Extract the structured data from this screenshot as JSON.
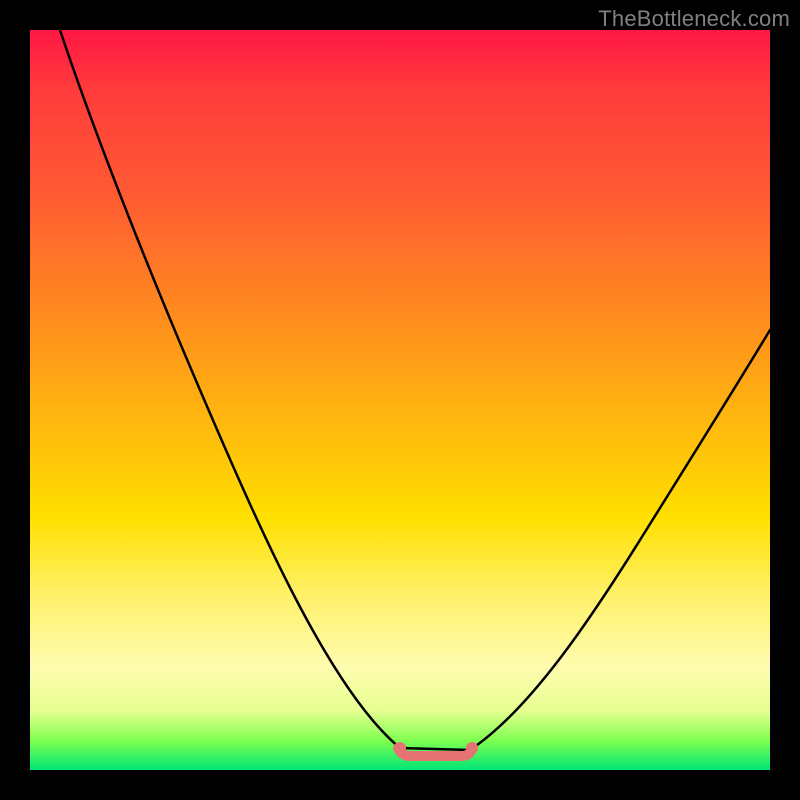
{
  "watermark": "TheBottleneck.com",
  "chart_data": {
    "type": "line",
    "title": "",
    "xlabel": "",
    "ylabel": "",
    "xlim": [
      0,
      100
    ],
    "ylim": [
      0,
      100
    ],
    "categories": [
      0,
      5,
      10,
      15,
      20,
      25,
      30,
      35,
      40,
      45,
      50,
      55,
      57,
      60,
      65,
      70,
      75,
      80,
      85,
      90,
      95,
      100
    ],
    "series": [
      {
        "name": "bottleneck-curve",
        "values": [
          100,
          92,
          83,
          74.5,
          66,
          57.5,
          49,
          40.5,
          32,
          23.5,
          14,
          5,
          1,
          1,
          5,
          11,
          18,
          25,
          32,
          39,
          45.5,
          52
        ]
      }
    ],
    "markers": {
      "name": "optimal-range",
      "x": [
        50,
        60
      ],
      "y": [
        2,
        2
      ]
    },
    "colors": {
      "curve": "#000000",
      "marker": "#e57373",
      "gradient_top": "#ff1744",
      "gradient_bottom": "#00e676"
    }
  }
}
